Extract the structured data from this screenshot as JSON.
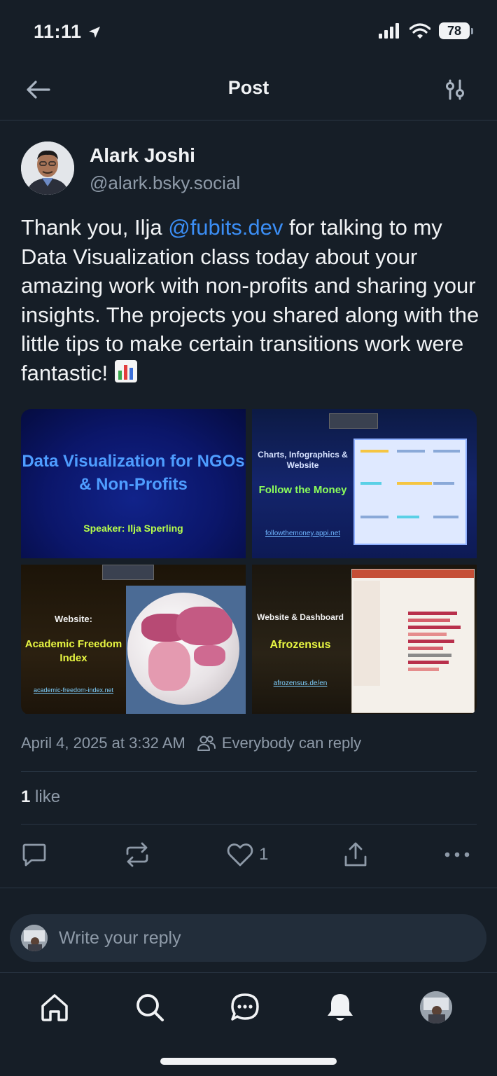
{
  "status_bar": {
    "time": "11:11",
    "battery": "78"
  },
  "header": {
    "title": "Post"
  },
  "author": {
    "name": "Alark Joshi",
    "handle": "@alark.bsky.social"
  },
  "post": {
    "text_before": "Thank you, Ilja ",
    "mention": "@fubits.dev",
    "text_after": " for talking to my Data Visualization class today about your amazing work with non-profits and sharing your insights. The projects you shared along with the little tips to make certain transitions work were fantastic! "
  },
  "slides": {
    "s1": {
      "title": "Data Visualization for NGOs & Non-Profits",
      "speaker": "Speaker: Ilja Sperling"
    },
    "s2": {
      "title": "Charts, Infographics & Website",
      "subtitle": "Follow the Money",
      "link": "followthemoney.appi.net"
    },
    "s3": {
      "label": "Website:",
      "title": "Academic Freedom Index",
      "link": "academic-freedom-index.net"
    },
    "s4": {
      "label": "Website & Dashboard",
      "title": "Afrozensus",
      "link": "afrozensus.de/en"
    }
  },
  "meta": {
    "date": "April 4, 2025 at 3:32 AM",
    "reply_setting": "Everybody can reply"
  },
  "likes": {
    "count": "1",
    "label": " like"
  },
  "actions": {
    "like_count": "1"
  },
  "reply": {
    "placeholder": "Write your reply"
  },
  "colors": {
    "accent": "#3b8ef5",
    "background": "#161e27",
    "muted": "#8e9aa8"
  },
  "icons": {
    "back": "arrow-left-icon",
    "filter": "sliders-icon",
    "reply": "speech-bubble-icon",
    "repost": "repost-icon",
    "like": "heart-icon",
    "share": "share-icon",
    "more": "more-icon",
    "home": "home-icon",
    "search": "search-icon",
    "chat": "chat-icon",
    "notifications": "bell-icon"
  }
}
